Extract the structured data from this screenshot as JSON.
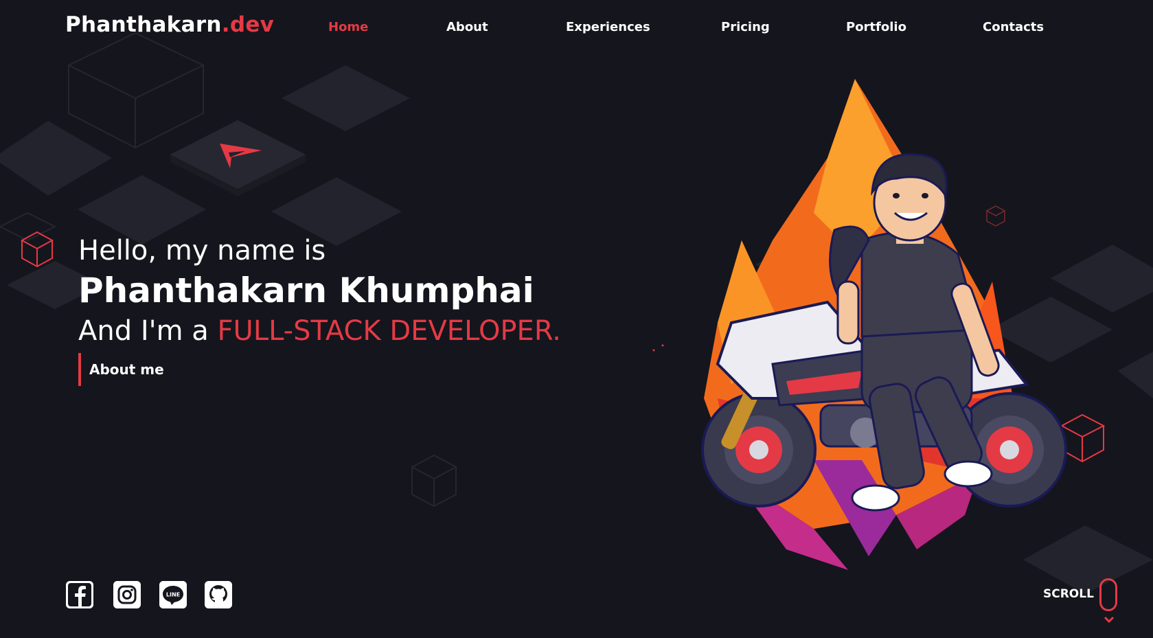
{
  "brand": {
    "name": "Phanthakarn",
    "suffix": ".dev"
  },
  "nav": {
    "items": [
      {
        "label": "Home",
        "active": true
      },
      {
        "label": "About",
        "active": false
      },
      {
        "label": "Experiences",
        "active": false
      },
      {
        "label": "Pricing",
        "active": false
      },
      {
        "label": "Portfolio",
        "active": false
      },
      {
        "label": "Contacts",
        "active": false
      }
    ]
  },
  "hero": {
    "greeting": "Hello, my name is",
    "name": "Phanthakarn Khumphai",
    "role_prefix": "And I'm a ",
    "role_highlight": "FULL-STACK DEVELOPER.",
    "cta_label": "About me"
  },
  "socials": [
    {
      "icon": "facebook-icon"
    },
    {
      "icon": "instagram-icon"
    },
    {
      "icon": "line-icon",
      "text": "LINE"
    },
    {
      "icon": "github-icon"
    }
  ],
  "scroll": {
    "label": "SCROLL"
  },
  "colors": {
    "background": "#15151d",
    "accent": "#e53a45",
    "tile": "#23232d",
    "text": "#ffffff"
  }
}
